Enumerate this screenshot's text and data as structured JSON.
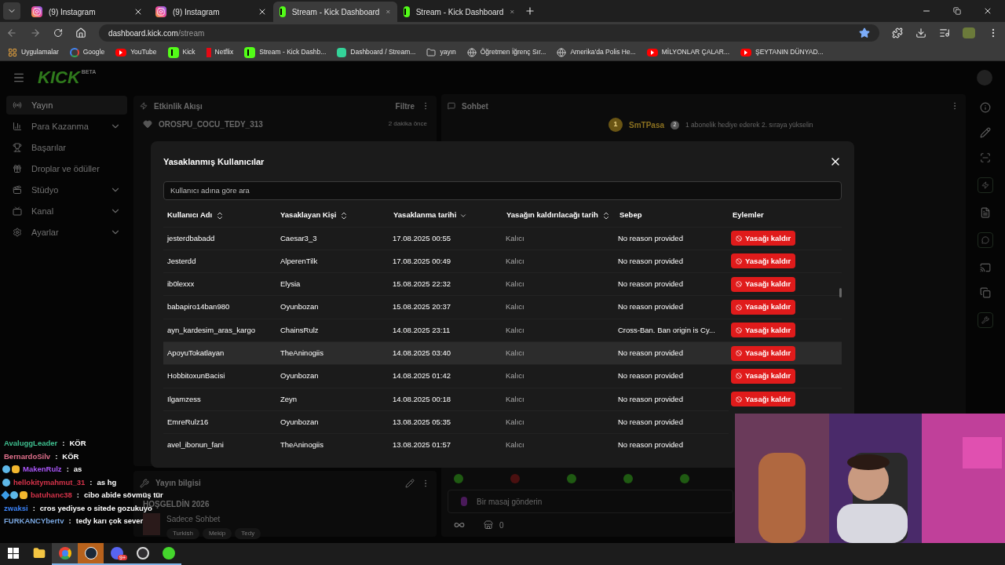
{
  "browser": {
    "tabs": [
      {
        "title": "(9) Instagram",
        "selected": false
      },
      {
        "title": "(9) Instagram",
        "selected": false
      },
      {
        "title": "Stream - Kick Dashboard",
        "selected": true
      },
      {
        "title": "Stream - Kick Dashboard",
        "selected": false
      }
    ],
    "url_host": "dashboard.kick.com",
    "url_path": "/stream",
    "bookmarks": [
      {
        "label": "Uygulamalar"
      },
      {
        "label": "Google"
      },
      {
        "label": "YouTube"
      },
      {
        "label": "Kick"
      },
      {
        "label": "Netflix"
      },
      {
        "label": "Stream - Kick Dashb..."
      },
      {
        "label": "Dashboard / Stream..."
      },
      {
        "label": "yayın"
      },
      {
        "label": "Öğretmen İğrenç Sır..."
      },
      {
        "label": "Amerika'da Polis He..."
      },
      {
        "label": "MİLYONLAR ÇALAR..."
      },
      {
        "label": "ŞEYTANIN DÜNYAD..."
      }
    ]
  },
  "sidebar": {
    "logo": "KICK",
    "logo_badge": "BETA",
    "items": [
      {
        "label": "Yayın",
        "selected": true,
        "expandable": false
      },
      {
        "label": "Para Kazanma",
        "selected": false,
        "expandable": true
      },
      {
        "label": "Başarılar",
        "selected": false,
        "expandable": false
      },
      {
        "label": "Droplar ve ödüller",
        "selected": false,
        "expandable": false
      },
      {
        "label": "Stüdyo",
        "selected": false,
        "expandable": true
      },
      {
        "label": "Kanal",
        "selected": false,
        "expandable": true
      },
      {
        "label": "Ayarlar",
        "selected": false,
        "expandable": true
      }
    ]
  },
  "activity": {
    "title": "Etkinlik Akışı",
    "filter": "Filtre",
    "events": [
      {
        "user": "OROSPU_COCU_TEDY_313",
        "time": "2 dakika önce"
      }
    ]
  },
  "chat": {
    "title": "Sohbet",
    "top_gifter": {
      "rank": "1",
      "name": "SmTPasa"
    },
    "gift_rank": "2",
    "gift_prompt": "1 abonelik hediye ederek 2. sıraya yükselin",
    "input_placeholder": "Bir masaj gönderin",
    "store_count": "0"
  },
  "stream_info": {
    "title": "Yayın bilgisi",
    "stream_title": "HOŞGELDİN 2026",
    "category": "Sadece Sohbet",
    "tags": [
      "Turkish",
      "Mekip",
      "Tedy"
    ]
  },
  "modal": {
    "title": "Yasaklanmış Kullanıcılar",
    "search_placeholder": "Kullanıcı adına göre ara",
    "columns": [
      {
        "label": "Kullanıcı Adı",
        "kind": "sortable"
      },
      {
        "label": "Yasaklayan Kişi",
        "kind": "sortable"
      },
      {
        "label": "Yasaklanma tarihi",
        "kind": "sorted"
      },
      {
        "label": "Yasağın kaldırılacağı tarih",
        "kind": "sortable"
      },
      {
        "label": "Sebep",
        "kind": "plain"
      },
      {
        "label": "Eylemler",
        "kind": "plain"
      }
    ],
    "rows": [
      {
        "user": "jesterdbabadd",
        "banned_by": "Caesar3_3",
        "date": "17.08.2025 00:55",
        "expires": "Kalıcı",
        "reason": "No reason provided",
        "action": "Yasağı kaldır",
        "hovered": false
      },
      {
        "user": "Jesterdd",
        "banned_by": "AlperenTilk",
        "date": "17.08.2025 00:49",
        "expires": "Kalıcı",
        "reason": "No reason provided",
        "action": "Yasağı kaldır",
        "hovered": false
      },
      {
        "user": "ib0lexxx",
        "banned_by": "Elysia",
        "date": "15.08.2025 22:32",
        "expires": "Kalıcı",
        "reason": "No reason provided",
        "action": "Yasağı kaldır",
        "hovered": false
      },
      {
        "user": "babapiro14ban980",
        "banned_by": "Oyunbozan",
        "date": "15.08.2025 20:37",
        "expires": "Kalıcı",
        "reason": "No reason provided",
        "action": "Yasağı kaldır",
        "hovered": false
      },
      {
        "user": "ayn_kardesim_aras_kargo",
        "banned_by": "ChainsRulz",
        "date": "14.08.2025 23:11",
        "expires": "Kalıcı",
        "reason": "Cross-Ban. Ban origin is Cy...",
        "action": "Yasağı kaldır",
        "hovered": false
      },
      {
        "user": "ApoyuTokatlayan",
        "banned_by": "TheAninogiis",
        "date": "14.08.2025 03:40",
        "expires": "Kalıcı",
        "reason": "No reason provided",
        "action": "Yasağı kaldır",
        "hovered": true
      },
      {
        "user": "HobbitoxunBacisi",
        "banned_by": "Oyunbozan",
        "date": "14.08.2025 01:42",
        "expires": "Kalıcı",
        "reason": "No reason provided",
        "action": "Yasağı kaldır",
        "hovered": false
      },
      {
        "user": "Ilgamzess",
        "banned_by": "Zeyn",
        "date": "14.08.2025 00:18",
        "expires": "Kalıcı",
        "reason": "No reason provided",
        "action": "Yasağı kaldır",
        "hovered": false
      },
      {
        "user": "EmreRulz16",
        "banned_by": "Oyunbozan",
        "date": "13.08.2025 05:35",
        "expires": "Kalıcı",
        "reason": "No reason provided",
        "hovered": false
      },
      {
        "user": "avel_ibonun_fani",
        "banned_by": "TheAninogiis",
        "date": "13.08.2025 01:57",
        "expires": "Kalıcı",
        "reason": "No reason provided",
        "hovered": false
      }
    ]
  },
  "overlay_chat": [
    {
      "user": "AvaluggLeader",
      "color": "#3fbf8f",
      "separator": ":",
      "message": "KÖR"
    },
    {
      "user": "BernardoSilv",
      "color": "#e0708c",
      "separator": ":",
      "message": "KÖR"
    },
    {
      "user": "MakenRulz",
      "color": "#a855f7",
      "badges": [
        {
          "kind": "bear"
        },
        {
          "kind": "crown"
        }
      ],
      "separator": ":",
      "message": "as"
    },
    {
      "user": "hellokitymahmut_31",
      "color": "#d6334a",
      "badges": [
        {
          "kind": "bear"
        }
      ],
      "separator": ":",
      "message": "as hg"
    },
    {
      "user": "batuhanc38",
      "color": "#d6334a",
      "badges": [
        {
          "kind": "cube"
        },
        {
          "kind": "bear"
        },
        {
          "kind": "crown"
        }
      ],
      "separator": ":",
      "message": "cibo abide sövmüş tür"
    },
    {
      "user": "zwaksi",
      "color": "#3b82f6",
      "separator": ":",
      "message": "cros yediyse o sitede gozukuyo"
    },
    {
      "user": "FURKANCYbertv",
      "color": "#7aa7e0",
      "separator": ":",
      "message": "tedy karı çok sever"
    }
  ],
  "taskbar": {
    "apps": [
      {
        "kind": "start",
        "active": false
      },
      {
        "kind": "files",
        "active": false
      },
      {
        "kind": "chrome",
        "active": true
      },
      {
        "kind": "steam",
        "active": true
      },
      {
        "kind": "discord",
        "active": true,
        "badge": "9+"
      },
      {
        "kind": "obs",
        "active": true
      },
      {
        "kind": "razer",
        "active": true
      }
    ]
  }
}
